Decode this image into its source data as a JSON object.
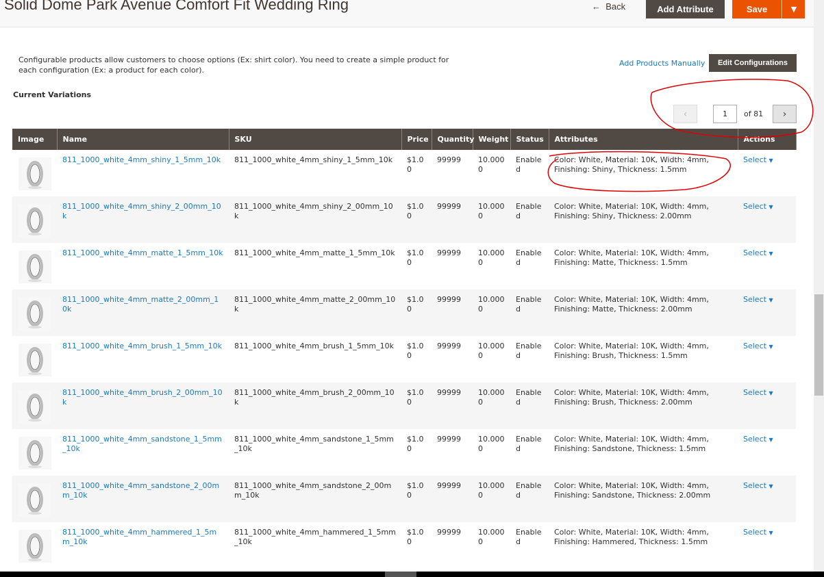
{
  "header": {
    "title": "Solid Dome Park Avenue Comfort Fit Wedding Ring",
    "back_label": "Back",
    "add_attribute_label": "Add Attribute",
    "save_label": "Save"
  },
  "section": {
    "description": "Configurable products allow customers to choose options (Ex: shirt color). You need to create a simple product for each configuration (Ex: a product for each color).",
    "add_products_manually": "Add Products Manually",
    "edit_configurations": "Edit Configurations",
    "current_variations": "Current Variations"
  },
  "pagination": {
    "current_page": "1",
    "of_label": "of 81"
  },
  "table": {
    "columns": [
      "Image",
      "Name",
      "SKU",
      "Price",
      "Quantity",
      "Weight",
      "Status",
      "Attributes",
      "Actions"
    ],
    "rows": [
      {
        "name": "811_1000_white_4mm_shiny_1_5mm_10k",
        "sku": "811_1000_white_4mm_shiny_1_5mm_10k",
        "price": "$1.00",
        "qty": "99999",
        "weight": "10.0000",
        "status": "Enabled",
        "attributes": "Color: White, Material: 10K, Width: 4mm, Finishing: Shiny, Thickness: 1.5mm",
        "action": "Select"
      },
      {
        "name": "811_1000_white_4mm_shiny_2_00mm_10k",
        "sku": "811_1000_white_4mm_shiny_2_00mm_10k",
        "price": "$1.00",
        "qty": "99999",
        "weight": "10.0000",
        "status": "Enabled",
        "attributes": "Color: White, Material: 10K, Width: 4mm, Finishing: Shiny, Thickness: 2.00mm",
        "action": "Select"
      },
      {
        "name": "811_1000_white_4mm_matte_1_5mm_10k",
        "sku": "811_1000_white_4mm_matte_1_5mm_10k",
        "price": "$1.00",
        "qty": "99999",
        "weight": "10.0000",
        "status": "Enabled",
        "attributes": "Color: White, Material: 10K, Width: 4mm, Finishing: Matte, Thickness: 1.5mm",
        "action": "Select"
      },
      {
        "name": "811_1000_white_4mm_matte_2_00mm_10k",
        "sku": "811_1000_white_4mm_matte_2_00mm_10k",
        "price": "$1.00",
        "qty": "99999",
        "weight": "10.0000",
        "status": "Enabled",
        "attributes": "Color: White, Material: 10K, Width: 4mm, Finishing: Matte, Thickness: 2.00mm",
        "action": "Select"
      },
      {
        "name": "811_1000_white_4mm_brush_1_5mm_10k",
        "sku": "811_1000_white_4mm_brush_1_5mm_10k",
        "price": "$1.00",
        "qty": "99999",
        "weight": "10.0000",
        "status": "Enabled",
        "attributes": "Color: White, Material: 10K, Width: 4mm, Finishing: Brush, Thickness: 1.5mm",
        "action": "Select"
      },
      {
        "name": "811_1000_white_4mm_brush_2_00mm_10k",
        "sku": "811_1000_white_4mm_brush_2_00mm_10k",
        "price": "$1.00",
        "qty": "99999",
        "weight": "10.0000",
        "status": "Enabled",
        "attributes": "Color: White, Material: 10K, Width: 4mm, Finishing: Brush, Thickness: 2.00mm",
        "action": "Select"
      },
      {
        "name": "811_1000_white_4mm_sandstone_1_5mm_10k",
        "sku": "811_1000_white_4mm_sandstone_1_5mm_10k",
        "price": "$1.00",
        "qty": "99999",
        "weight": "10.0000",
        "status": "Enabled",
        "attributes": "Color: White, Material: 10K, Width: 4mm, Finishing: Sandstone, Thickness: 1.5mm",
        "action": "Select"
      },
      {
        "name": "811_1000_white_4mm_sandstone_2_00mm_10k",
        "sku": "811_1000_white_4mm_sandstone_2_00mm_10k",
        "price": "$1.00",
        "qty": "99999",
        "weight": "10.0000",
        "status": "Enabled",
        "attributes": "Color: White, Material: 10K, Width: 4mm, Finishing: Sandstone, Thickness: 2.00mm",
        "action": "Select"
      },
      {
        "name": "811_1000_white_4mm_hammered_1_5mm_10k",
        "sku": "811_1000_white_4mm_hammered_1_5mm_10k",
        "price": "$1.00",
        "qty": "99999",
        "weight": "10.0000",
        "status": "Enabled",
        "attributes": "Color: White, Material: 10K, Width: 4mm, Finishing: Hammered, Thickness: 1.5mm",
        "action": "Select"
      }
    ]
  },
  "colors": {
    "accent": "#eb5202",
    "header_bg": "#514943",
    "link": "#1979c3",
    "annotation": "#e00000"
  }
}
